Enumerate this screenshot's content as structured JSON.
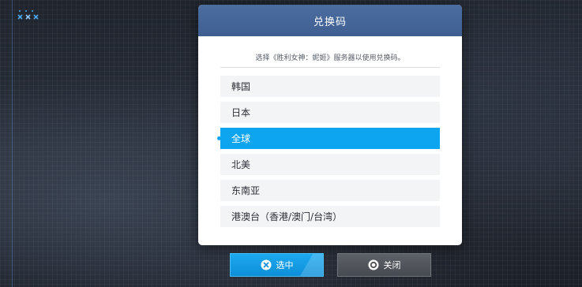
{
  "dialog": {
    "title": "兑换码",
    "subtitle": "选择《胜利女神：妮姬》服务器以使用兑换码。",
    "servers": [
      {
        "label": "韩国",
        "selected": false
      },
      {
        "label": "日本",
        "selected": false
      },
      {
        "label": "全球",
        "selected": true
      },
      {
        "label": "北美",
        "selected": false
      },
      {
        "label": "东南亚",
        "selected": false
      },
      {
        "label": "港澳台（香港/澳门/台湾）",
        "selected": false
      }
    ]
  },
  "buttons": {
    "confirm_label": "选中",
    "close_label": "关闭"
  },
  "colors": {
    "header": "#4567a0",
    "selected": "#0ea5f0",
    "confirm_button": "#1a9fe6",
    "close_button": "#52565c"
  }
}
